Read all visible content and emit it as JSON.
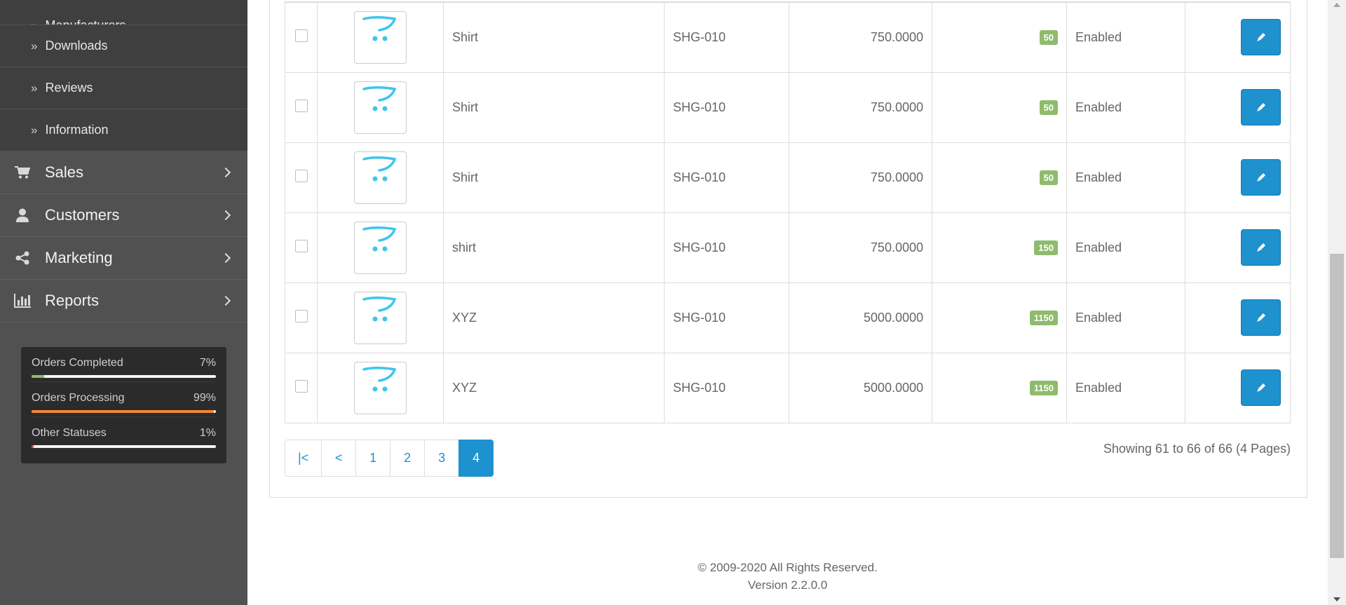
{
  "sidebar": {
    "sub_items": [
      {
        "label": "Manufacturers"
      },
      {
        "label": "Downloads"
      },
      {
        "label": "Reviews"
      },
      {
        "label": "Information"
      }
    ],
    "main_items": [
      {
        "label": "Sales",
        "icon": "shopping-cart-icon"
      },
      {
        "label": "Customers",
        "icon": "user-icon"
      },
      {
        "label": "Marketing",
        "icon": "share-icon"
      },
      {
        "label": "Reports",
        "icon": "bar-chart-icon"
      }
    ],
    "stats": [
      {
        "label": "Orders Completed",
        "value": "7%",
        "fraction": 0.07,
        "color": "#8fbb6c"
      },
      {
        "label": "Orders Processing",
        "value": "99%",
        "fraction": 0.99,
        "color": "#f38733"
      },
      {
        "label": "Other Statuses",
        "value": "1%",
        "fraction": 0.01,
        "color": "#e3503e"
      }
    ]
  },
  "products": {
    "rows": [
      {
        "name": "Shirt",
        "model": "SHG-010",
        "price": "750.0000",
        "quantity": "50",
        "status": "Enabled"
      },
      {
        "name": "Shirt",
        "model": "SHG-010",
        "price": "750.0000",
        "quantity": "50",
        "status": "Enabled"
      },
      {
        "name": "Shirt",
        "model": "SHG-010",
        "price": "750.0000",
        "quantity": "50",
        "status": "Enabled"
      },
      {
        "name": "shirt",
        "model": "SHG-010",
        "price": "750.0000",
        "quantity": "150",
        "status": "Enabled"
      },
      {
        "name": "XYZ",
        "model": "SHG-010",
        "price": "5000.0000",
        "quantity": "1150",
        "status": "Enabled"
      },
      {
        "name": "XYZ",
        "model": "SHG-010",
        "price": "5000.0000",
        "quantity": "1150",
        "status": "Enabled"
      }
    ]
  },
  "pagination": {
    "first": "|<",
    "prev": "<",
    "pages": [
      "1",
      "2",
      "3",
      "4"
    ],
    "active": "4",
    "summary": "Showing 61 to 66 of 66 (4 Pages)"
  },
  "footer": {
    "copyright": "© 2009-2020 All Rights Reserved.",
    "version": "Version 2.2.0.0"
  },
  "colors": {
    "accent": "#1e91cf",
    "badge": "#8fbb6c",
    "sidebar": "#515151"
  }
}
